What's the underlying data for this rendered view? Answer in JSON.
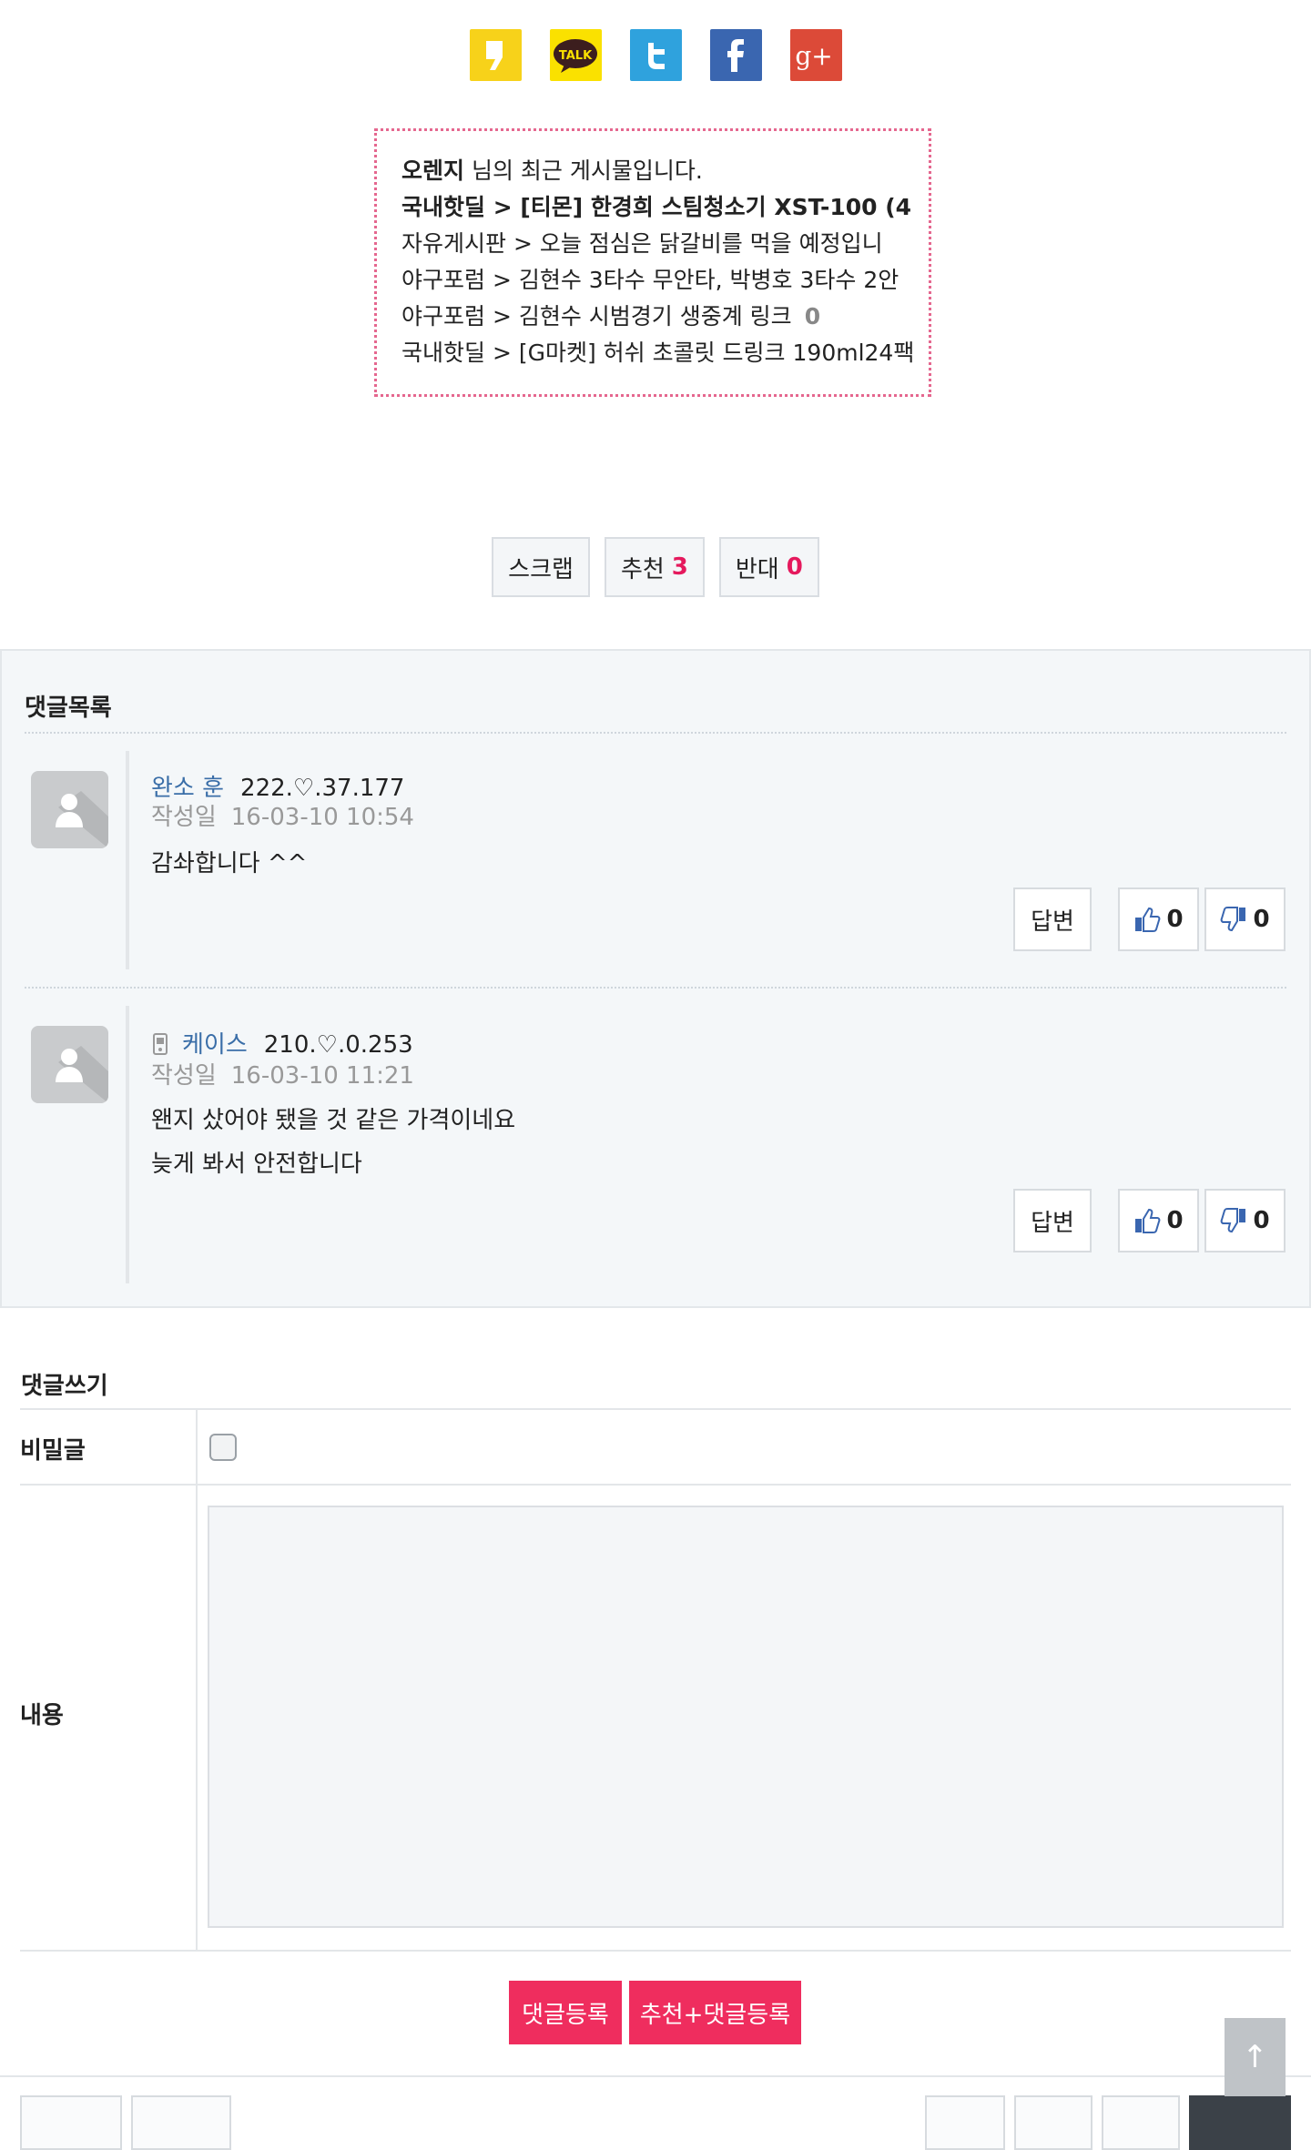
{
  "share": {
    "icons": [
      "kakaostory-icon",
      "kakaotalk-icon",
      "twitter-icon",
      "facebook-icon",
      "googleplus-icon"
    ],
    "talk_label": "TALK",
    "gplus_label": "g+"
  },
  "recent": {
    "author": "오렌지",
    "intro": " 님의 최근 게시물입니다.",
    "posts": [
      {
        "text": "국내핫딜 > [티몬] 한경희 스팀청소기 XST-100 (4",
        "bold": true
      },
      {
        "text": "자유게시판 > 오늘 점심은 닭갈비를 먹을 예정입니",
        "bold": false
      },
      {
        "text": "야구포럼 > 김현수 3타수 무안타, 박병호 3타수 2안",
        "bold": false
      },
      {
        "text": "야구포럼 > 김현수 시범경기 생중계 링크",
        "bold": false,
        "count": "0"
      },
      {
        "text": "국내핫딜 > [G마켓] 허쉬 초콜릿 드링크 190ml24팩",
        "bold": false
      }
    ]
  },
  "actions": {
    "scrap": "스크랩",
    "recommend_label": "추천",
    "recommend_count": "3",
    "oppose_label": "반대",
    "oppose_count": "0"
  },
  "comments": {
    "title": "댓글목록",
    "items": [
      {
        "name": "완소 훈",
        "ip": "222.♡.37.177",
        "date_label": "작성일",
        "date": "16-03-10 10:54",
        "lines": [
          "감솨합니다 ^^"
        ],
        "reply": "답변",
        "good": "0",
        "bad": "0",
        "mobile": false
      },
      {
        "name": "케이스",
        "ip": "210.♡.0.253",
        "date_label": "작성일",
        "date": "16-03-10 11:21",
        "lines": [
          "왠지 샀어야 됐을 것 같은 가격이네요",
          "늦게 봐서 안전합니다"
        ],
        "reply": "답변",
        "good": "0",
        "bad": "0",
        "mobile": true
      }
    ]
  },
  "write": {
    "title": "댓글쓰기",
    "secret_label": "비밀글",
    "content_label": "내용",
    "content_value": "",
    "submit": "댓글등록",
    "submit_recommend": "추천+댓글등록"
  },
  "totop": "↑",
  "colors": {
    "accent": "#ef2d5e",
    "count": "#e5195d",
    "link": "#3a6ea8",
    "panel": "#f4f7f9",
    "recent_border": "#e5678f"
  }
}
